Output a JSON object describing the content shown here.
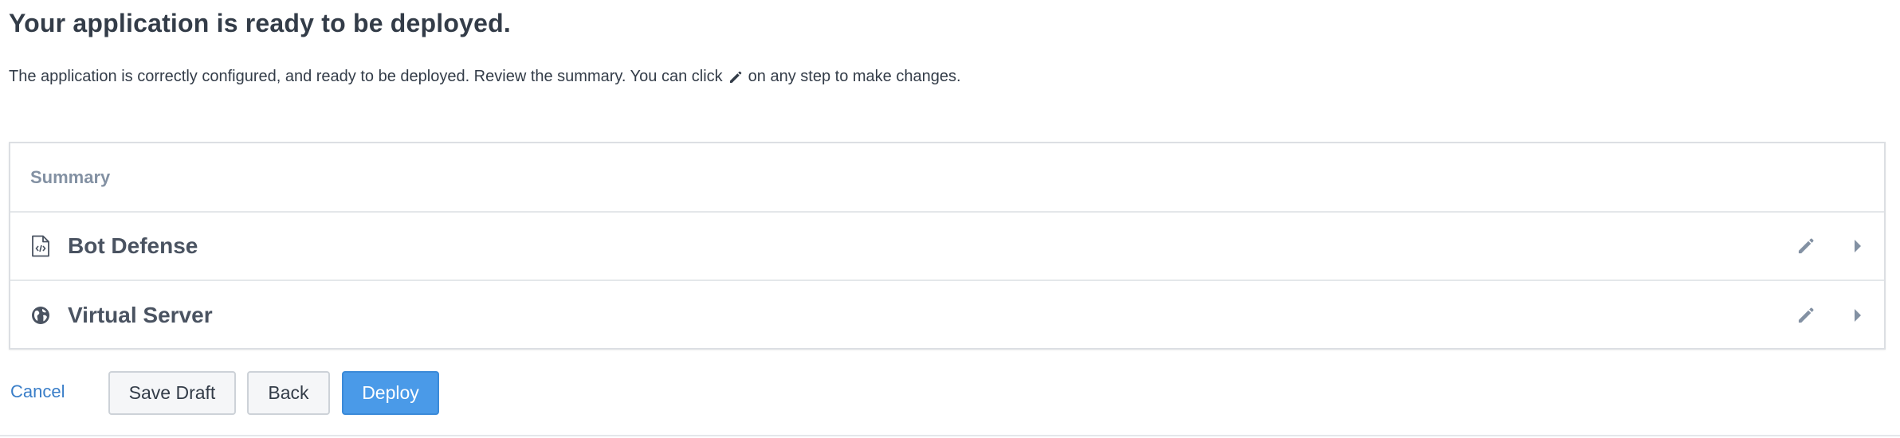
{
  "page": {
    "title": "Your application is ready to be deployed.",
    "intro_before": "The application is correctly configured, and ready to be deployed. Review the summary. You can click",
    "intro_after": "on any step to make changes.",
    "intro_icon": "pencil-icon"
  },
  "summary": {
    "header": "Summary",
    "items": [
      {
        "label": "Bot Defense",
        "icon": "code-file-icon",
        "edit_icon": "pencil-icon",
        "expand_icon": "caret-right-icon"
      },
      {
        "label": "Virtual Server",
        "icon": "globe-icon",
        "edit_icon": "pencil-icon",
        "expand_icon": "caret-right-icon"
      }
    ]
  },
  "actions": {
    "cancel_label": "Cancel",
    "save_draft_label": "Save Draft",
    "back_label": "Back",
    "deploy_label": "Deploy"
  },
  "colors": {
    "text": "#333c48",
    "muted": "#8391a3",
    "link": "#3a7ec8",
    "primary": "#4a9ae8",
    "border": "#dcdfe3"
  }
}
